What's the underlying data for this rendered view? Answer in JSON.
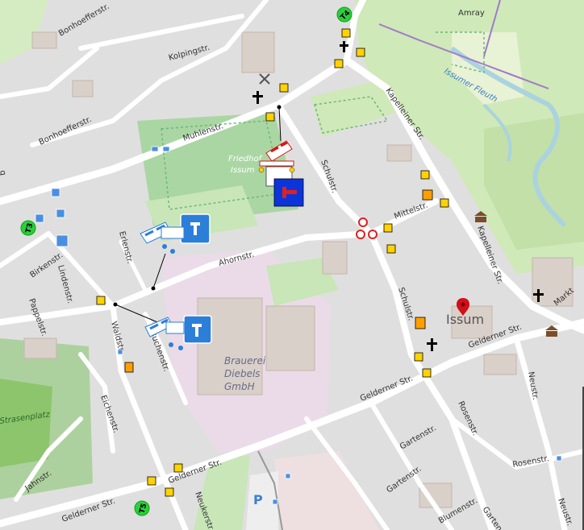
{
  "map": {
    "streets": [
      "Bonhoefferstr.",
      "Kolpingstr.",
      "Bonhoefferstr.",
      "Muhlenstr.",
      "Kapelleiner Str.",
      "Schulstr.",
      "Mittelstr.",
      "Kapelleiner Str.",
      "Ahornstr.",
      "Erlenstr.",
      "Birkenstr.",
      "Lindenstr.",
      "Pappelstr.",
      "Waldstr.",
      "Buchenstr.",
      "Eichenstr.",
      "Schulstr.",
      "Gelderner Str.",
      "Gelderner Str.",
      "Rosenstr.",
      "Neustr.",
      "Rosenstr.",
      "Gartenstr.",
      "Gartenstr.",
      "Blumenstr.",
      "Gelderner Str.",
      "Gelderner Str.",
      "Neukerstr.",
      "Jahnstr.",
      "Garten",
      "Markt",
      "Neustr.",
      "g"
    ],
    "places": {
      "amray": "Amray",
      "river": "Issumer Fleuth",
      "cemetery_line1": "Friedhof",
      "cemetery_line2": "Issum",
      "town": "Issum",
      "brewery_line1": "Brauerei",
      "brewery_line2": "Diebels",
      "brewery_line3": "GmbH",
      "sports": "Strasenplatz"
    },
    "stops": [
      "T4",
      "T3",
      "T5"
    ],
    "parking": "P",
    "colors": {
      "tram_stop": "#2ecc40",
      "roadwork_blue": "#2b7fd9",
      "closure_red": "#e02020",
      "town_marker": "#d0101a",
      "traffic_sign": "#ffd200"
    },
    "icons": [
      "church-icon",
      "windmill-icon",
      "museum-icon",
      "town-marker-icon",
      "tram-stop",
      "traffic-sign-icon",
      "info-sign-icon",
      "no-entry-icon",
      "roadwork-marker"
    ]
  }
}
